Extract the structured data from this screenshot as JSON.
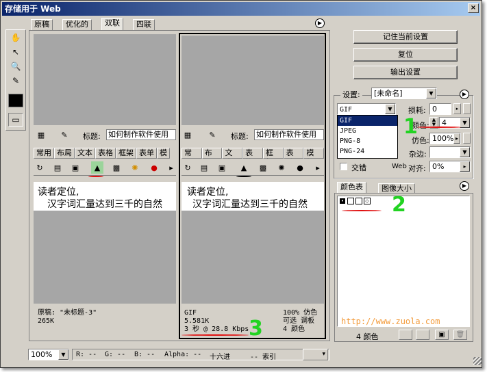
{
  "window": {
    "title": "存储用于 Web",
    "close": "×"
  },
  "view_tabs": [
    "原稿",
    "优化的",
    "双联",
    "四联"
  ],
  "left_pane": {
    "title_label": "标题:",
    "title_value": "如何制作软件使用",
    "tabs": [
      "常用",
      "布局",
      "文本",
      "表格",
      "框架",
      "表单",
      "模"
    ],
    "text_line1": "读者定位,",
    "text_line2": "汉字词汇量达到三千的自然",
    "info_name": "原稿: \"未标题-3\"",
    "info_size": "265K"
  },
  "right_pane": {
    "title_label": "标题:",
    "title_value": "如何制作软件使用",
    "tabs": [
      "常用",
      "布局",
      "文本",
      "表格",
      "框架",
      "表单",
      "模板"
    ],
    "text_line1": "读者定位,",
    "text_line2": "汉字词汇量达到三千的自然",
    "info_format": "GIF",
    "info_size": "5.581K",
    "info_time": "3 秒 @ 28.8 Kbps",
    "info_dither": "100% 仿色",
    "info_palette": "可选 调板",
    "info_colors": "4 颜色"
  },
  "buttons": {
    "remember": "记住当前设置",
    "reset": "复位",
    "output": "输出设置"
  },
  "settings": {
    "settings_label": "设置:",
    "settings_value": "[未命名]",
    "format_value": "GIF",
    "format_options": [
      "GIF",
      "JPEG",
      "PNG-8",
      "PNG-24"
    ],
    "loss_label": "损耗:",
    "loss_value": "0",
    "colors_label": "颜色:",
    "colors_value": "4",
    "dither_label": "仿色:",
    "dither_value": "100%",
    "matte_label": "杂边:",
    "interlace_label": "交错",
    "web_label": "Web",
    "web_snap_label": "对齐:",
    "web_snap_value": "0%"
  },
  "color_table": {
    "tab_colors": "颜色表",
    "tab_size": "图像大小",
    "count": "4 颜色",
    "watermark": "http://www.zuola.com"
  },
  "annotations": {
    "one": "1",
    "two": "2",
    "three": "3"
  },
  "status": {
    "zoom": "100%",
    "r": "R:  --",
    "g": "G:  --",
    "b": "B:  --",
    "alpha": "Alpha:  --",
    "hex": "十六进",
    "index": "--   索引"
  },
  "colors": {
    "accent": "#0a246a",
    "annot_green": "#22d322",
    "annot_red": "#e01010",
    "selection": "#0a246a"
  }
}
